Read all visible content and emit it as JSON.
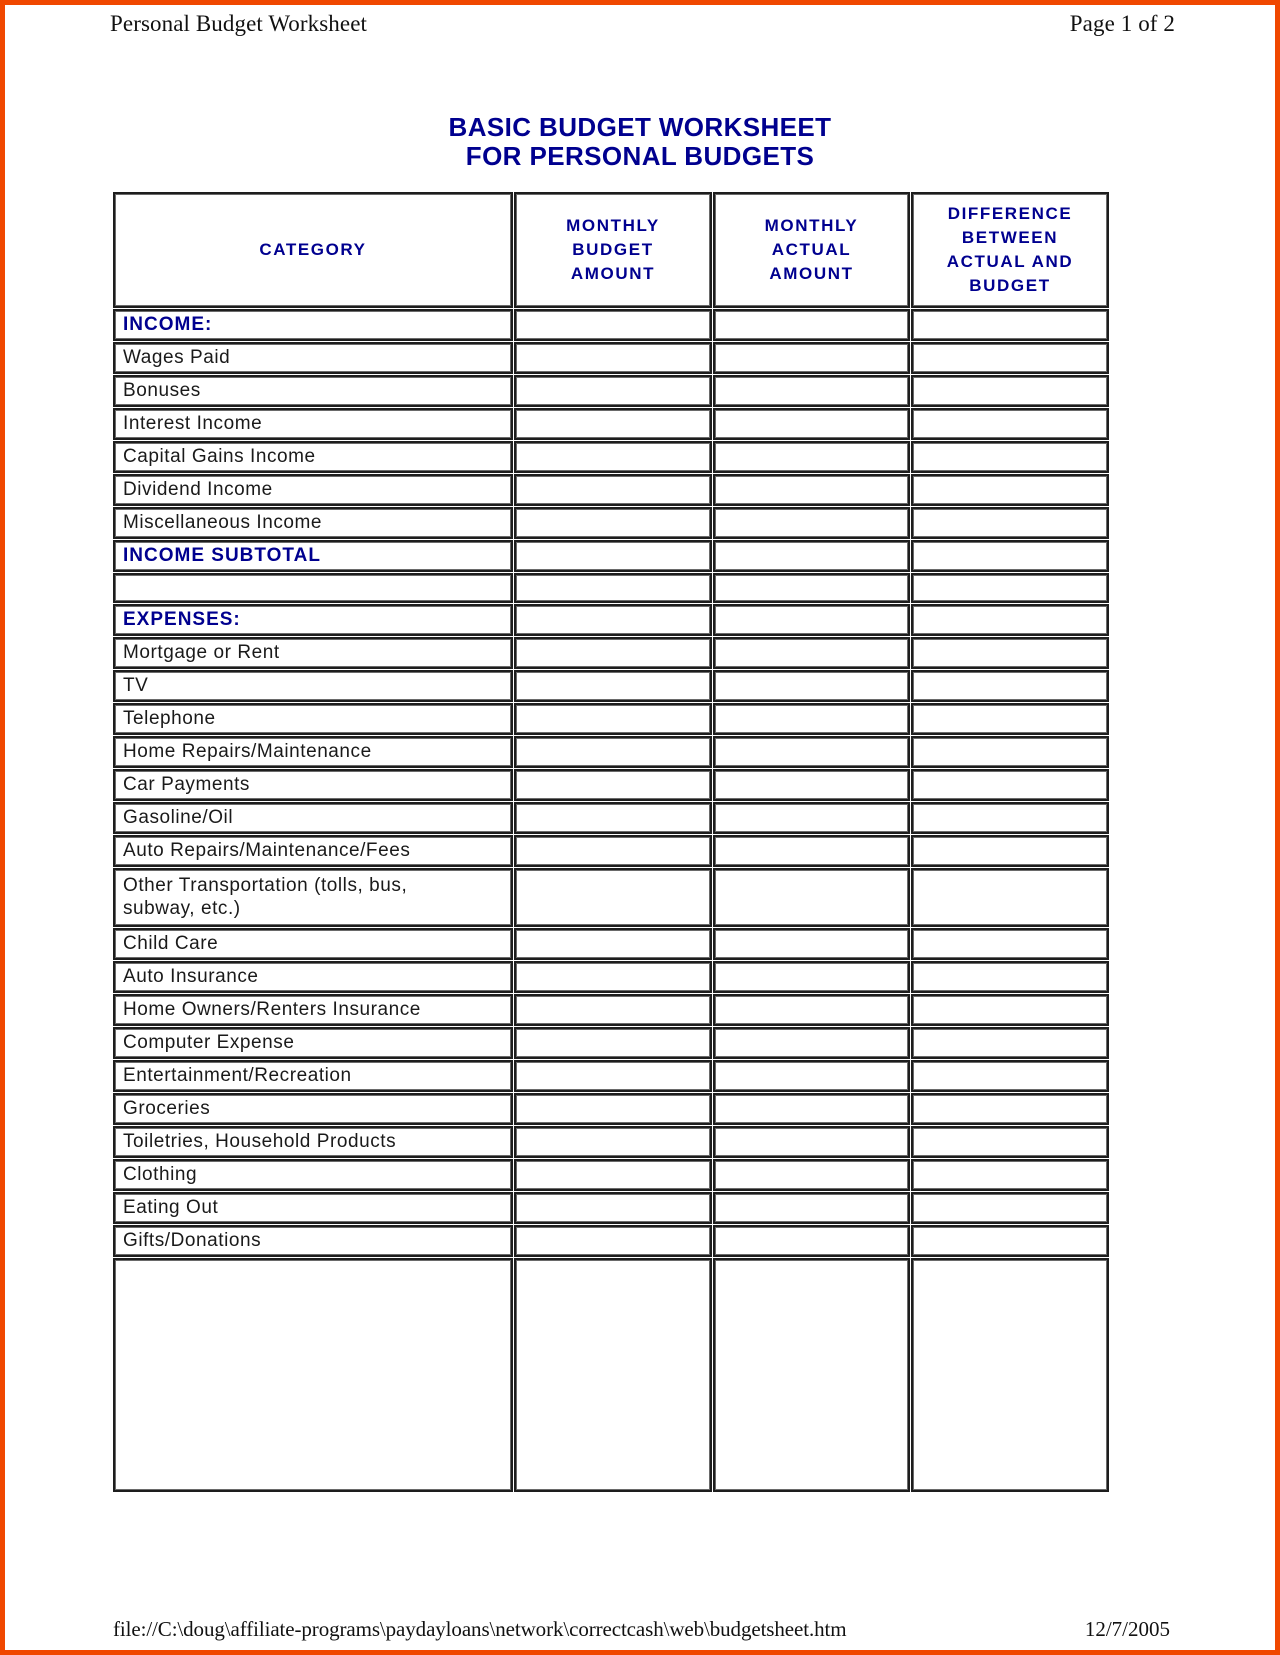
{
  "page": {
    "border_color": "#f04800",
    "running_head_left": "Personal Budget Worksheet",
    "running_head_right": "Page 1 of 2",
    "footer_path": "file://C:\\doug\\affiliate-programs\\paydayloans\\network\\correctcash\\web\\budgetsheet.htm",
    "footer_date": "12/7/2005"
  },
  "title": {
    "line1": "BASIC BUDGET WORKSHEET",
    "line2": "FOR PERSONAL BUDGETS",
    "color": "#00008f"
  },
  "table": {
    "headers": {
      "category": [
        "CATEGORY"
      ],
      "budget": [
        "MONTHLY",
        "BUDGET",
        "AMOUNT"
      ],
      "actual": [
        "MONTHLY",
        "ACTUAL",
        "AMOUNT"
      ],
      "difference": [
        "DIFFERENCE",
        "BETWEEN",
        "ACTUAL AND",
        "BUDGET"
      ]
    },
    "rows": [
      {
        "label": "INCOME:",
        "type": "section"
      },
      {
        "label": "Wages Paid",
        "type": "item"
      },
      {
        "label": "Bonuses",
        "type": "item"
      },
      {
        "label": "Interest Income",
        "type": "item"
      },
      {
        "label": "Capital Gains Income",
        "type": "item"
      },
      {
        "label": "Dividend Income",
        "type": "item"
      },
      {
        "label": "Miscellaneous Income",
        "type": "item"
      },
      {
        "label": "INCOME SUBTOTAL",
        "type": "section"
      },
      {
        "label": "",
        "type": "spacer"
      },
      {
        "label": "EXPENSES:",
        "type": "section"
      },
      {
        "label": "Mortgage or Rent",
        "type": "item"
      },
      {
        "label": "TV",
        "type": "item"
      },
      {
        "label": "Telephone",
        "type": "item"
      },
      {
        "label": "Home Repairs/Maintenance",
        "type": "item"
      },
      {
        "label": "Car Payments",
        "type": "item"
      },
      {
        "label": "Gasoline/Oil",
        "type": "item"
      },
      {
        "label": "Auto Repairs/Maintenance/Fees",
        "type": "item"
      },
      {
        "label": "Other Transportation (tolls, bus,\nsubway, etc.)",
        "type": "item-tall"
      },
      {
        "label": "Child Care",
        "type": "item"
      },
      {
        "label": "Auto Insurance",
        "type": "item"
      },
      {
        "label": "Home Owners/Renters Insurance",
        "type": "item"
      },
      {
        "label": "Computer Expense",
        "type": "item"
      },
      {
        "label": "Entertainment/Recreation",
        "type": "item"
      },
      {
        "label": "Groceries",
        "type": "item"
      },
      {
        "label": "Toiletries, Household Products",
        "type": "item"
      },
      {
        "label": "Clothing",
        "type": "item"
      },
      {
        "label": "Eating Out",
        "type": "item"
      },
      {
        "label": "Gifts/Donations",
        "type": "item"
      },
      {
        "label": "",
        "type": "filler"
      }
    ]
  }
}
